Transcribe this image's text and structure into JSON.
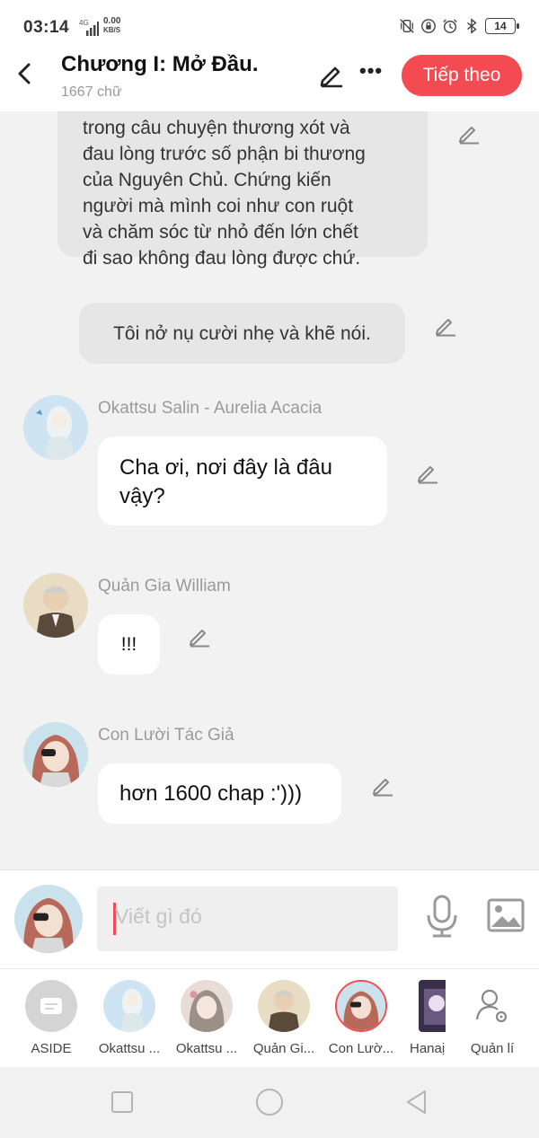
{
  "status": {
    "time": "03:14",
    "network": "4G",
    "speed_value": "0.00",
    "speed_unit": "KB/S",
    "battery": "14"
  },
  "header": {
    "title": "Chương I: Mở Đầu.",
    "word_count": "1667 chữ",
    "next_label": "Tiếp theo"
  },
  "messages": {
    "narration_1": "trong câu chuyện thương xót và\nđau lòng trước số phận bi thương\ncủa Nguyên Chủ. Chứng kiến\nngười mà mình coi như con ruột\nvà chăm sóc từ nhỏ đến lớn chết\nđi sao không đau lòng được chứ.",
    "narration_2": "Tôi nở nụ cười nhẹ và khẽ nói.",
    "m1_speaker": "Okattsu Salin - Aurelia Acacia",
    "m1_text": "Cha ơi, nơi đây là đâu vậy?",
    "m2_speaker": "Quản Gia William",
    "m2_text": "!!!",
    "m3_speaker": "Con Lười Tác Giả",
    "m3_text": "hơn 1600 chap :')))"
  },
  "input": {
    "placeholder": "Viết gì đó"
  },
  "characters": [
    {
      "label": "ASIDE"
    },
    {
      "label": "Okattsu ..."
    },
    {
      "label": "Okattsu ..."
    },
    {
      "label": "Quản Gi..."
    },
    {
      "label": "Con Lườ..."
    },
    {
      "label": "Hanaị"
    },
    {
      "label": "Quản lí"
    }
  ],
  "colors": {
    "accent": "#f44a52",
    "background": "#f2f2f2",
    "bubble_grey": "#e6e6e6"
  }
}
